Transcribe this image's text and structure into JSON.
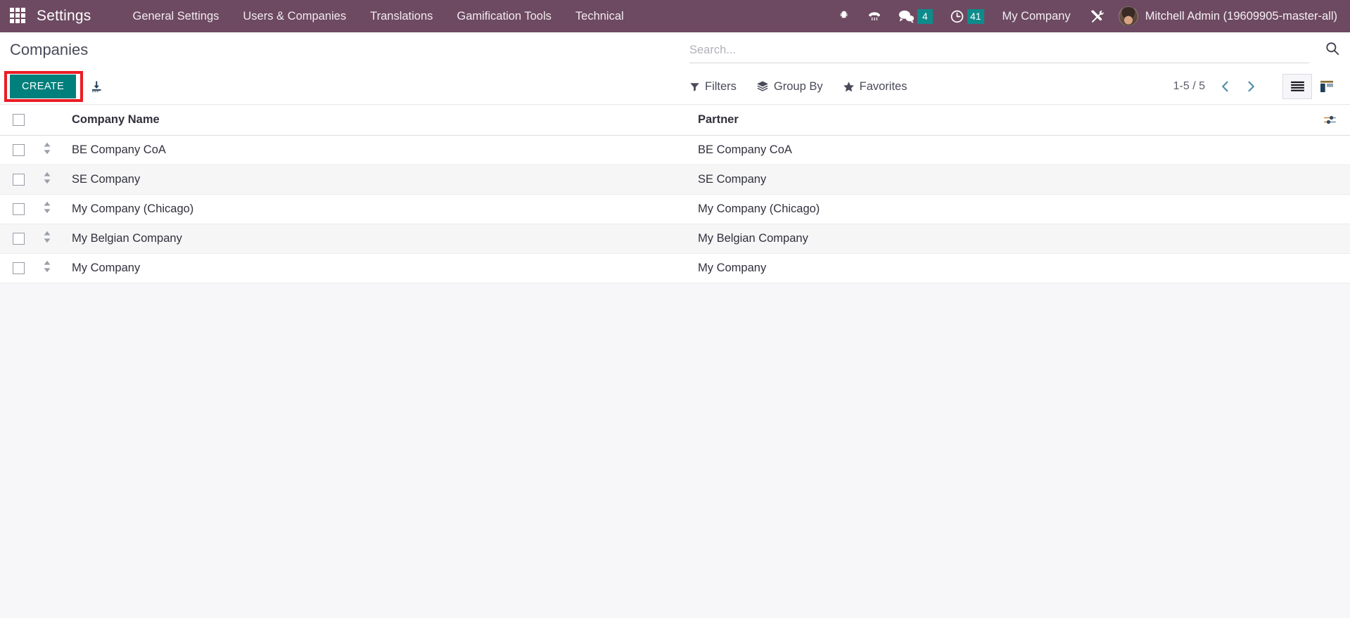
{
  "navbar": {
    "apps_icon": "apps-grid-icon",
    "brand": "Settings",
    "menu_items": [
      {
        "label": "General Settings"
      },
      {
        "label": "Users & Companies"
      },
      {
        "label": "Translations"
      },
      {
        "label": "Gamification Tools"
      },
      {
        "label": "Technical"
      }
    ],
    "systray": {
      "debug_icon": "bug-icon",
      "voip_icon": "phone-keypad-icon",
      "messages_icon": "chat-bubbles-icon",
      "messages_count": "4",
      "activities_icon": "clock-icon",
      "activities_count": "41",
      "company": "My Company",
      "tools_icon": "wrench-screwdriver-icon",
      "badge_color": "#0e8b8b"
    },
    "user": {
      "name": "Mitchell Admin (19609905-master-all)",
      "avatar": "user-avatar"
    },
    "background_color": "#6d4a61"
  },
  "control_panel": {
    "title": "Companies",
    "create_label": "CREATE",
    "create_color": "#00807c",
    "highlight_color": "#ec1c24",
    "import_icon": "import-download-icon",
    "search": {
      "placeholder": "Search...",
      "value": "",
      "icon": "search-icon"
    },
    "filters": [
      {
        "label": "Filters",
        "icon": "funnel-icon"
      },
      {
        "label": "Group By",
        "icon": "layers-icon"
      },
      {
        "label": "Favorites",
        "icon": "star-icon"
      }
    ],
    "pager": {
      "range": "1-5 / 5",
      "prev_icon": "chevron-left-icon",
      "next_icon": "chevron-right-icon"
    },
    "views": [
      {
        "name": "list",
        "icon": "list-view-icon",
        "active": true
      },
      {
        "name": "kanban",
        "icon": "kanban-view-icon",
        "active": false
      }
    ],
    "optional_columns_icon": "sliders-icon"
  },
  "list": {
    "columns": [
      {
        "key": "name",
        "label": "Company Name"
      },
      {
        "key": "partner",
        "label": "Partner"
      }
    ],
    "rows": [
      {
        "name": "BE Company CoA",
        "partner": "BE Company CoA"
      },
      {
        "name": "SE Company",
        "partner": "SE Company"
      },
      {
        "name": "My Company (Chicago)",
        "partner": "My Company (Chicago)"
      },
      {
        "name": "My Belgian Company",
        "partner": "My Belgian Company"
      },
      {
        "name": "My Company",
        "partner": "My Company"
      }
    ]
  }
}
